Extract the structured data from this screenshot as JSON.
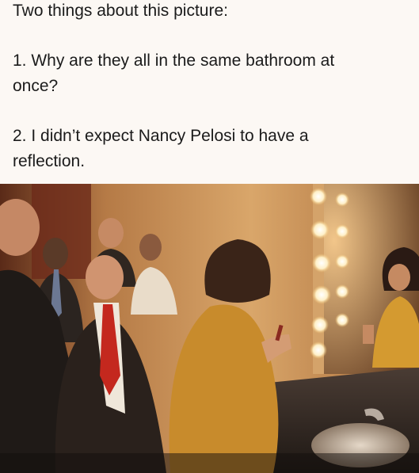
{
  "caption": {
    "intro": "Two things about this picture:",
    "point_1": {
      "line_1": "1. Why are they all in the same bathroom at",
      "line_2": "once?"
    },
    "point_2": {
      "line_1": "2. I didn’t expect Nancy Pelosi to have a",
      "line_2": "reflection."
    }
  },
  "photo": {
    "subject": "group-of-people-in-bathroom-with-vanity-mirror",
    "colors": {
      "wall": "#c9955a",
      "mirror_glow": "#e8b878",
      "bulb": "#fff6dc",
      "suit_dark": "#2a211c",
      "red_tie": "#c4281e",
      "mustard_top": "#c88b2c",
      "counter": "#3a302b",
      "sink": "#c8b8a6"
    }
  }
}
